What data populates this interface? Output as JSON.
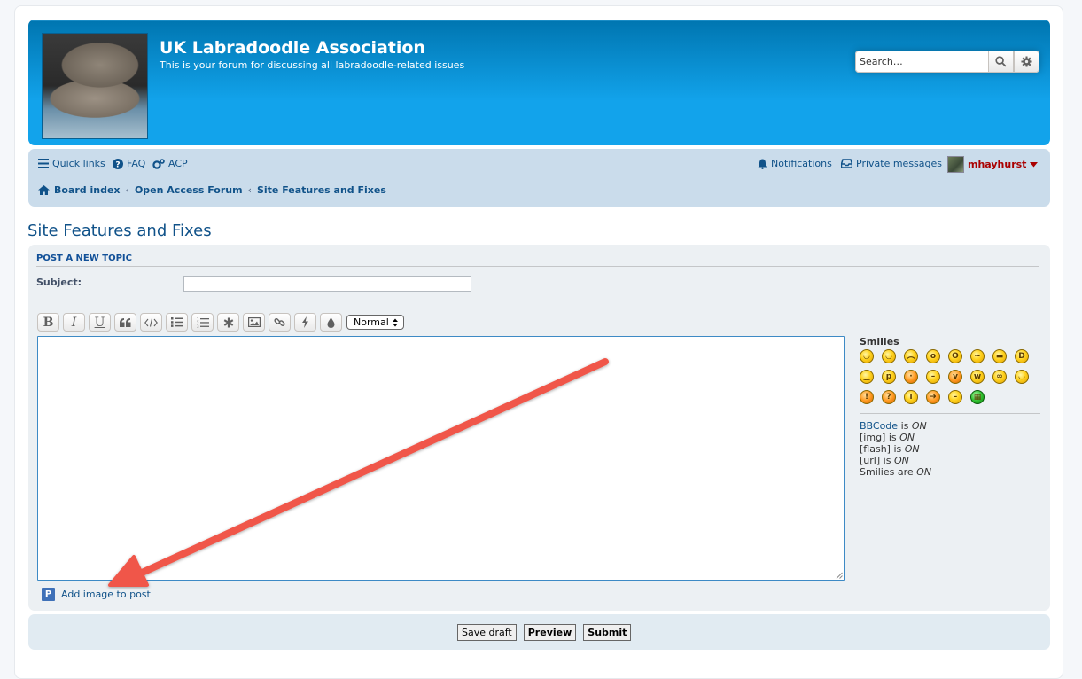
{
  "header": {
    "site_title": "UK Labradoodle Association",
    "site_description": "This is your forum for discussing all labradoodle-related issues",
    "search_placeholder": "Search…"
  },
  "navbar": {
    "quick_links": "Quick links",
    "faq": "FAQ",
    "acp": "ACP",
    "notifications": "Notifications",
    "private_messages": "Private messages",
    "username": "mhayhurst",
    "breadcrumbs": [
      "Board index",
      "Open Access Forum",
      "Site Features and Fixes"
    ]
  },
  "page": {
    "title": "Site Features and Fixes"
  },
  "post_form": {
    "panel_heading": "POST A NEW TOPIC",
    "subject_label": "Subject:",
    "subject_value": "",
    "toolbar": [
      "bold",
      "italic",
      "underline",
      "quote",
      "code",
      "list",
      "numbered-list",
      "list-item",
      "image",
      "link",
      "flash",
      "color"
    ],
    "bold_glyph": "B",
    "italic_glyph": "I",
    "underline_glyph": "U",
    "font_size_selected": "Normal",
    "add_image_label": "Add image to post",
    "add_image_icon_letter": "P"
  },
  "sidebar": {
    "smilies_title": "Smilies",
    "bbcode_link": "BBCode",
    "is": "is",
    "on": "ON",
    "img": "[img]",
    "flash": "[flash]",
    "url": "[url]",
    "smilies_are": "Smilies are"
  },
  "buttons": {
    "save_draft": "Save draft",
    "preview": "Preview",
    "submit": "Submit"
  },
  "colors": {
    "header_gradient": "#12a3eb",
    "navbar": "#cadceb",
    "link": "#105289",
    "username": "#aa0000",
    "annotation_arrow": "#f0564a"
  }
}
